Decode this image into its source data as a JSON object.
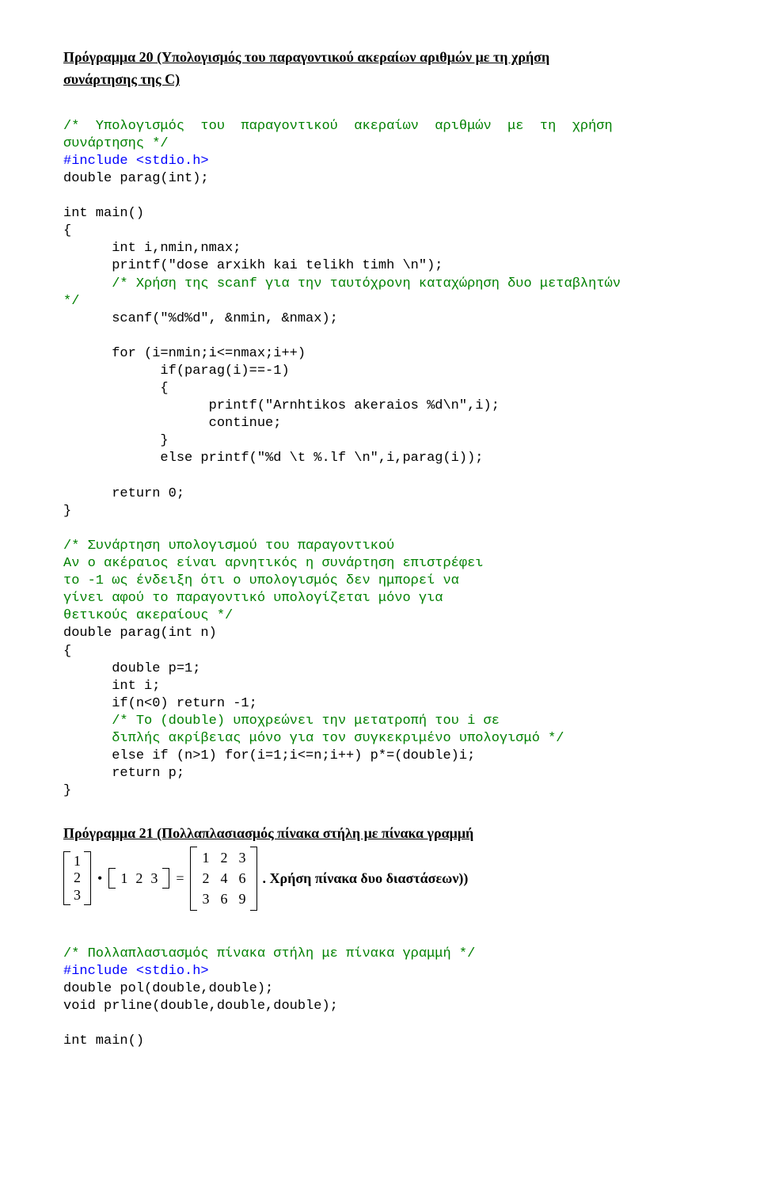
{
  "prog20": {
    "title_line1": "Πρόγραμμα 20 (Υπολογισμός του παραγοντικού ακεραίων αριθμών με τη χρήση",
    "title_line2": "συνάρτησης της C)",
    "c1": "/*  Υπολογισμός  του  παραγοντικού  ακεραίων  αριθμών  με  τη  χρήση",
    "c2": "συνάρτησης */",
    "c3": "#include <stdio.h>",
    "c4": "double parag(int);",
    "c5": "int main()",
    "c6": "{",
    "c7": "      int i,nmin,nmax;",
    "c8": "      printf(\"dose arxikh kai telikh timh \\n\");",
    "c9a": "      ",
    "c9b": "/* Χρήση της scanf για την ταυτόχρονη καταχώρηση δυο μεταβλητών",
    "c10": "*/",
    "c11": "      scanf(\"%d%d\", &nmin, &nmax);",
    "c12": "      for (i=nmin;i<=nmax;i++)",
    "c13": "            if(parag(i)==-1)",
    "c14": "            {",
    "c15": "                  printf(\"Arnhtikos akeraios %d\\n\",i);",
    "c16": "                  continue;",
    "c17": "            }",
    "c18": "            else printf(\"%d \\t %.lf \\n\",i,parag(i));",
    "c19": "      return 0;",
    "c20": "}",
    "c21": "/* Συνάρτηση υπολογισμού του παραγοντικού",
    "c22": "Αν ο ακέραιος είναι αρνητικός η συνάρτηση επιστρέφει",
    "c23": "το -1 ως ένδειξη ότι ο υπολογισμός δεν ημπορεί να",
    "c24": "γίνει αφού το παραγοντικό υπολογίζεται μόνο για",
    "c25": "θετικούς ακεραίους */",
    "c26": "double parag(int n)",
    "c27": "{",
    "c28": "      double p=1;",
    "c29": "      int i;",
    "c30": "      if(n<0) return -1;",
    "c31a": "      ",
    "c31b": "/* To (double) υποχρεώνει την μετατροπή του i σε",
    "c32": "      διπλής ακρίβειας μόνο για τον συγκεκριμένο υπολογισμό */",
    "c33": "      else if (n>1) for(i=1;i<=n;i++) p*=(double)i;",
    "c34": "      return p;",
    "c35": "}"
  },
  "prog21": {
    "title": "Πρόγραμμα  21  (Πολλαπλασιασμός  πίνακα  στήλη  με  πίνακα  γραμμή",
    "col": [
      "1",
      "2",
      "3"
    ],
    "dot": "•",
    "row": [
      "1",
      "2",
      "3"
    ],
    "eq": "=",
    "mat": [
      "1",
      "2",
      "3",
      "2",
      "4",
      "6",
      "3",
      "6",
      "9"
    ],
    "after": ". Χρήση πίνακα δυο διαστάσεων))",
    "d1": "/* Πολλαπλασιασμός πίνακα στήλη με πίνακα γραμμή */",
    "d2": "#include <stdio.h>",
    "d3": "double pol(double,double);",
    "d4": "void prline(double,double,double);",
    "d5": "int main()"
  }
}
